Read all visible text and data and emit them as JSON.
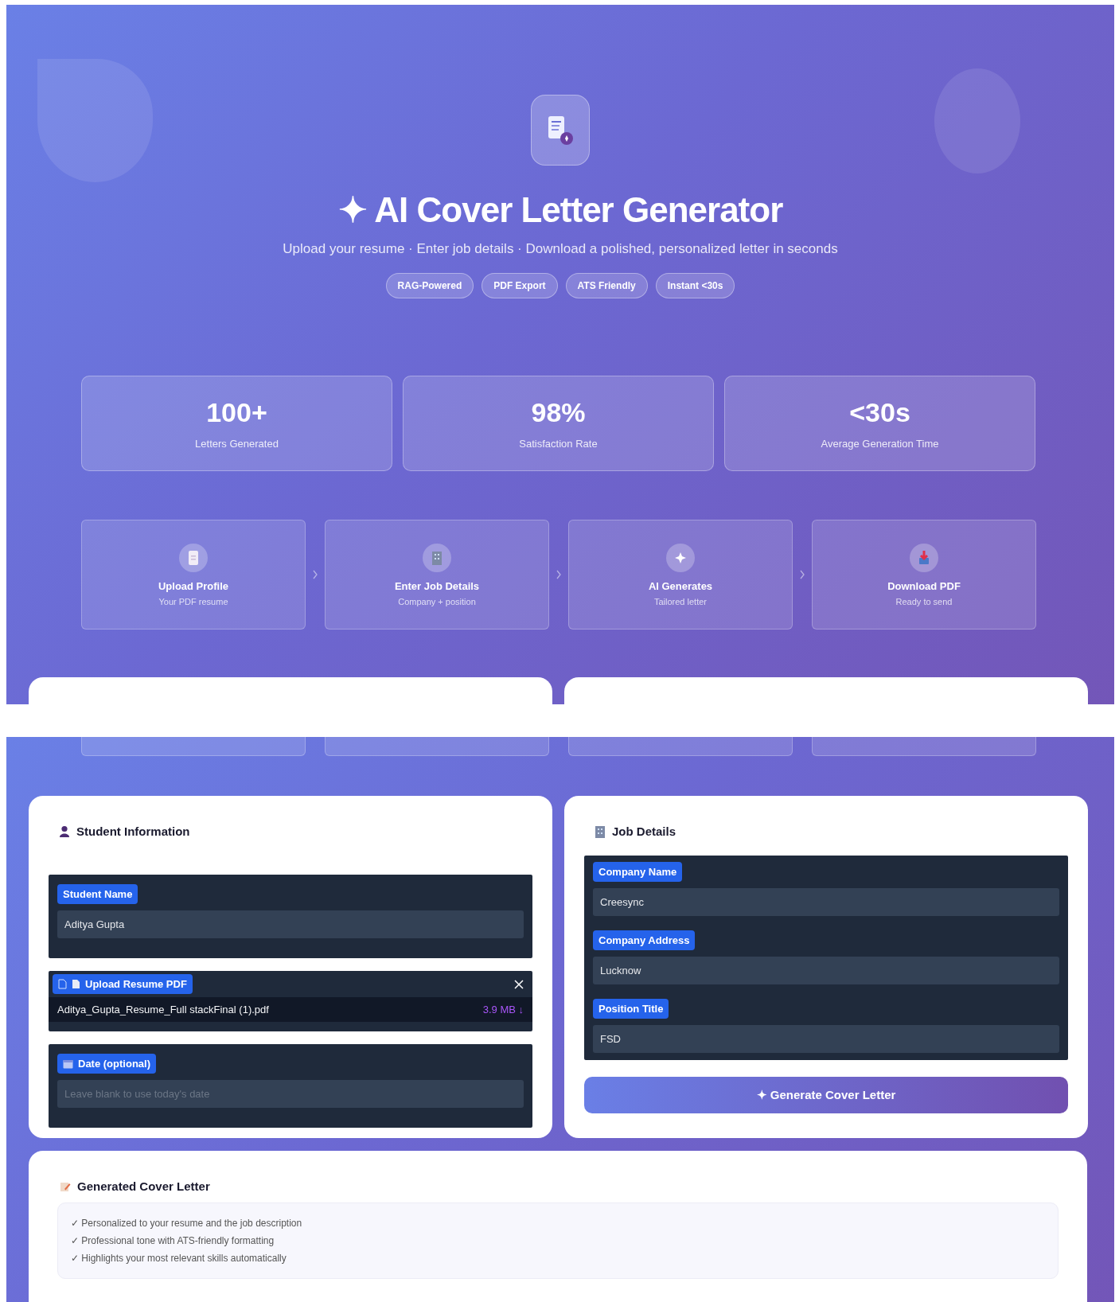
{
  "hero": {
    "title": "✦ AI Cover Letter Generator",
    "subtitle": "Upload your resume · Enter job details · Download a polished, personalized letter in seconds",
    "badges": [
      "RAG-Powered",
      "PDF Export",
      "ATS Friendly",
      "Instant <30s"
    ]
  },
  "stats": [
    {
      "value": "100+",
      "label": "Letters Generated"
    },
    {
      "value": "98%",
      "label": "Satisfaction Rate"
    },
    {
      "value": "<30s",
      "label": "Average Generation Time"
    }
  ],
  "steps": [
    {
      "title": "Upload Profile",
      "subtitle": "Your PDF resume"
    },
    {
      "title": "Enter Job Details",
      "subtitle": "Company + position"
    },
    {
      "title": "AI Generates",
      "subtitle": "Tailored letter"
    },
    {
      "title": "Download PDF",
      "subtitle": "Ready to send"
    }
  ],
  "student": {
    "title": "Student Information",
    "name_label": "Student Name",
    "name_value": "Aditya Gupta",
    "upload_label": "Upload Resume PDF",
    "file_name": "Aditya_Gupta_Resume_Full stackFinal (1).pdf",
    "file_size": "3.9 MB ↓",
    "date_label": "Date (optional)",
    "date_placeholder": "Leave blank to use today's date"
  },
  "job": {
    "title": "Job Details",
    "fields": [
      {
        "label": "Company Name",
        "value": "Creesync"
      },
      {
        "label": "Company Address",
        "value": "Lucknow"
      },
      {
        "label": "Position Title",
        "value": "FSD"
      }
    ],
    "button": "✦ Generate Cover Letter"
  },
  "output": {
    "title": "Generated Cover Letter",
    "points": [
      "✓ Personalized to your resume and the job description",
      "✓ Professional tone with ATS-friendly formatting",
      "✓ Highlights your most relevant skills automatically"
    ]
  }
}
